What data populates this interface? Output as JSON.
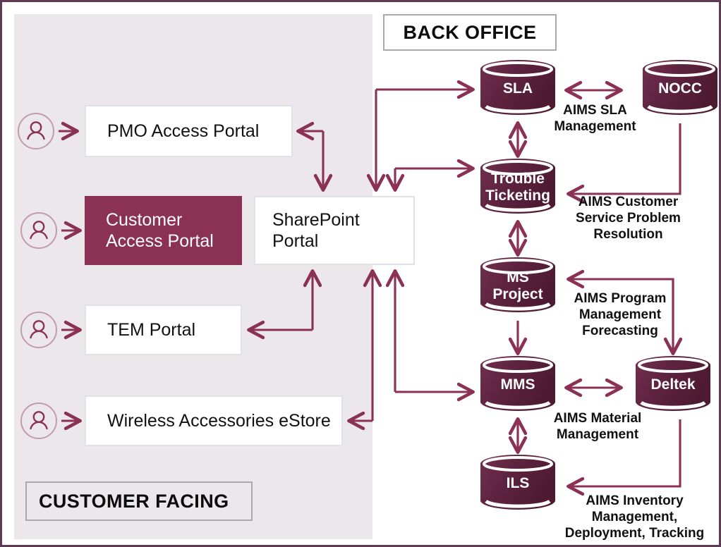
{
  "sections": {
    "back_office": "BACK OFFICE",
    "customer_facing": "CUSTOMER FACING"
  },
  "colors": {
    "page_border": "#5f3a54",
    "panel_bg": "#ece7ea",
    "accent": "#8a3154",
    "arrow": "#8a3154",
    "cylinder_dark": "#5e1f3a",
    "cylinder_light": "#7d3354",
    "box_border": "#dfe2e8",
    "section_border": "#a9a9a9",
    "actor_ring": "#c29bae"
  },
  "portals": [
    {
      "id": "pmo",
      "label": "PMO Access Portal",
      "filled": false,
      "has_actor": true
    },
    {
      "id": "customer",
      "label": "Customer\nAccess Portal",
      "filled": true,
      "has_actor": true
    },
    {
      "id": "tem",
      "label": "TEM Portal",
      "filled": false,
      "has_actor": true
    },
    {
      "id": "estore",
      "label": "Wireless Accessories eStore",
      "filled": false,
      "has_actor": true
    },
    {
      "id": "sharepoint",
      "label": "SharePoint\nPortal",
      "filled": false,
      "has_actor": false
    }
  ],
  "portal_labels": {
    "pmo": "PMO Access Portal",
    "customer_line1": "Customer",
    "customer_line2": "Access Portal",
    "tem": "TEM Portal",
    "estore": "Wireless Accessories eStore",
    "sharepoint_line1": "SharePoint",
    "sharepoint_line2": "Portal"
  },
  "datastores": [
    {
      "id": "sla",
      "label": "SLA",
      "line1": "SLA",
      "line2": ""
    },
    {
      "id": "nocc",
      "label": "NOCC",
      "line1": "NOCC",
      "line2": ""
    },
    {
      "id": "trouble",
      "label": "Trouble Ticketing",
      "line1": "Trouble",
      "line2": "Ticketing"
    },
    {
      "id": "msproj",
      "label": "MS Project",
      "line1": "MS",
      "line2": "Project"
    },
    {
      "id": "mms",
      "label": "MMS",
      "line1": "MMS",
      "line2": ""
    },
    {
      "id": "deltek",
      "label": "Deltek",
      "line1": "Deltek",
      "line2": ""
    },
    {
      "id": "ils",
      "label": "ILS",
      "line1": "ILS",
      "line2": ""
    }
  ],
  "annotations": {
    "sla_management": "AIMS SLA\nManagement",
    "sla_management_line1": "AIMS SLA",
    "sla_management_line2": "Management",
    "customer_service_line1": "AIMS Customer",
    "customer_service_line2": "Service Problem",
    "customer_service_line3": "Resolution",
    "program_mgmt_line1": "AIMS Program",
    "program_mgmt_line2": "Management",
    "program_mgmt_line3": "Forecasting",
    "material_mgmt_line1": "AIMS Material",
    "material_mgmt_line2": "Management",
    "inventory_line1": "AIMS Inventory",
    "inventory_line2": "Management,",
    "inventory_line3": "Deployment, Tracking"
  },
  "icons": {
    "actor": "person-icon",
    "datastore": "database-cylinder-icon",
    "arrow": "arrow-icon"
  }
}
